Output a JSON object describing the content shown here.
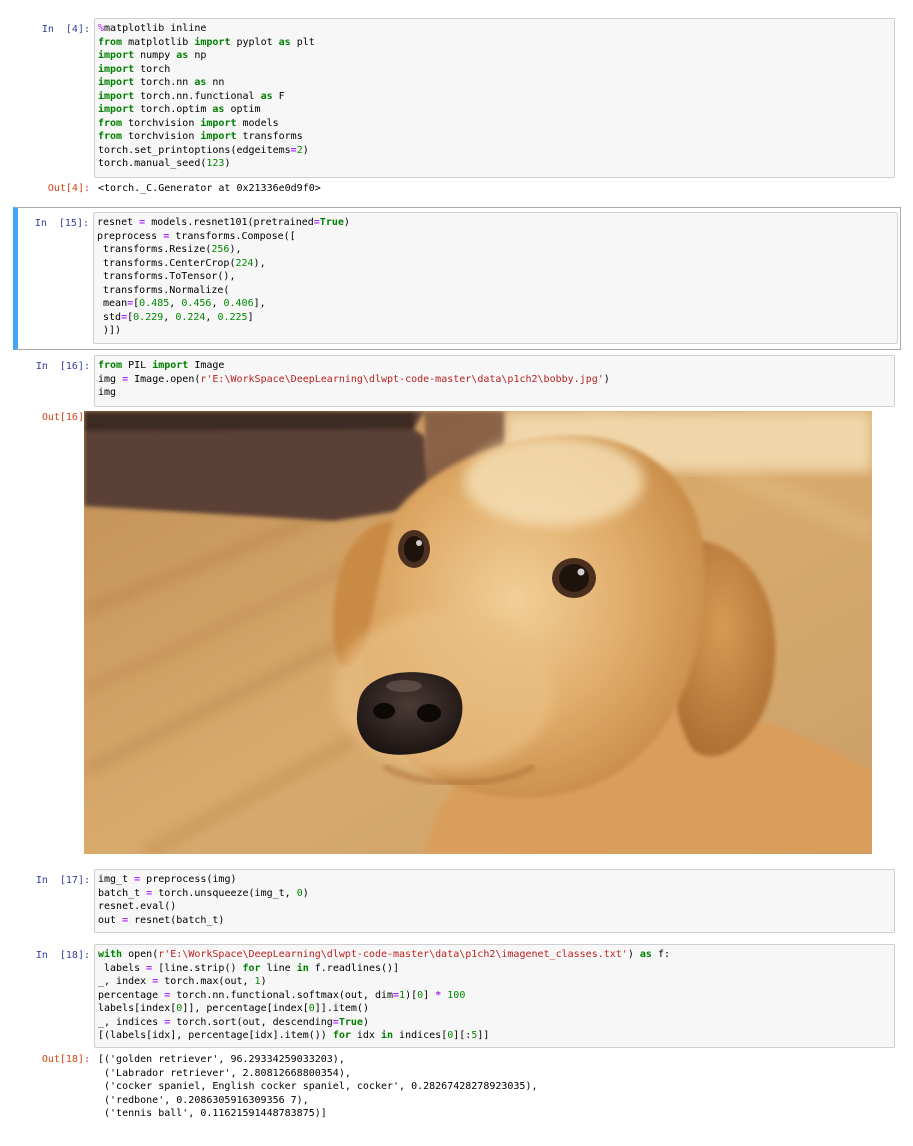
{
  "cells": [
    {
      "in_prompt": "In  [4]:",
      "code": "%matplotlib inline\nfrom matplotlib import pyplot as plt\nimport numpy as np\nimport torch\nimport torch.nn as nn\nimport torch.nn.functional as F\nimport torch.optim as optim\nfrom torchvision import models\nfrom torchvision import transforms\ntorch.set_printoptions(edgeitems=2)\ntorch.manual_seed(123)",
      "out_prompt": "Out[4]:",
      "output": "<torch._C.Generator at 0x21336e0d9f0>"
    },
    {
      "in_prompt": "In  [15]:",
      "code": "resnet = models.resnet101(pretrained=True)\npreprocess = transforms.Compose([\n transforms.Resize(256),\n transforms.CenterCrop(224),\n transforms.ToTensor(),\n transforms.Normalize(\n mean=[0.485, 0.456, 0.406],\n std=[0.229, 0.224, 0.225]\n )])",
      "selected": true
    },
    {
      "in_prompt": "In  [16]:",
      "code": "from PIL import Image\nimg = Image.open(r'E:\\WorkSpace\\DeepLearning\\dlwpt-code-master\\data\\p1ch2\\bobby.jpg')\nimg",
      "out_prompt": "Out[16]:",
      "output_image": "golden-retriever-photo"
    },
    {
      "in_prompt": "In  [17]:",
      "code": "img_t = preprocess(img)\nbatch_t = torch.unsqueeze(img_t, 0)\nresnet.eval()\nout = resnet(batch_t)"
    },
    {
      "in_prompt": "In  [18]:",
      "code": "with open(r'E:\\WorkSpace\\DeepLearning\\dlwpt-code-master\\data\\p1ch2\\imagenet_classes.txt') as f:\n labels = [line.strip() for line in f.readlines()]\n_, index = torch.max(out, 1)\npercentage = torch.nn.functional.softmax(out, dim=1)[0] * 100\nlabels[index[0]], percentage[index[0]].item()\n_, indices = torch.sort(out, descending=True)\n[(labels[idx], percentage[idx].item()) for idx in indices[0][:5]]",
      "out_prompt": "Out[18]:",
      "output": "[('golden retriever', 96.29334259033203),\n ('Labrador retriever', 2.80812668800354),\n ('cocker spaniel, English cocker spaniel, cocker', 0.28267428278923035),\n ('redbone', 0.2086305916309356 7),\n ('tennis ball', 0.11621591448783875)]"
    }
  ],
  "colors": {
    "in_prompt": "#303f9f",
    "out_prompt": "#d84315",
    "keyword": "#008000",
    "operator": "#aa22ff",
    "string": "#ba2121",
    "selected_bar": "#42a5f5"
  }
}
